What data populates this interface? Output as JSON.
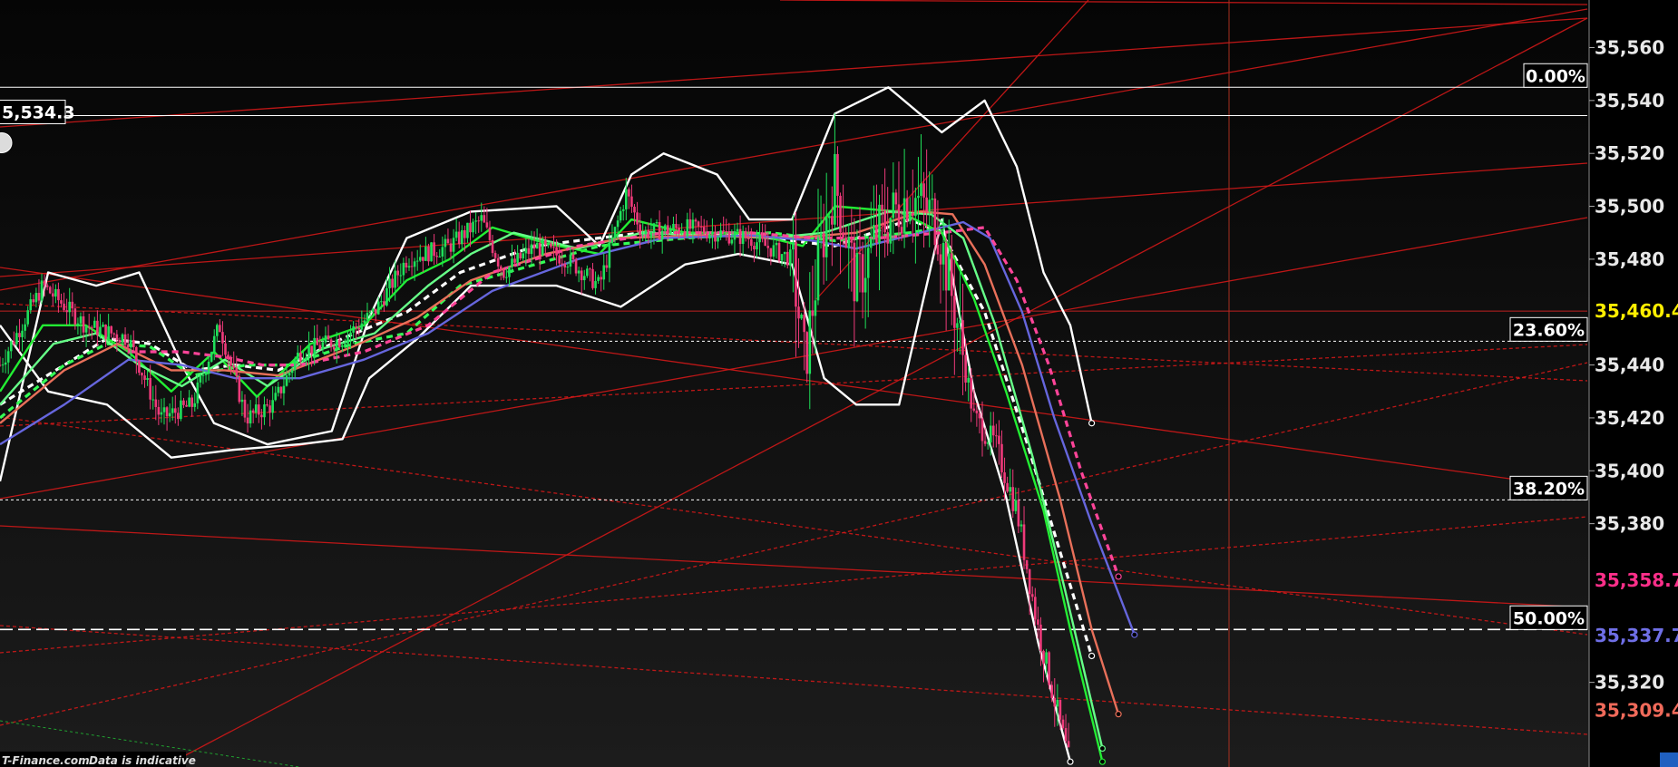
{
  "chart_data": {
    "type": "candlestick",
    "title": "",
    "xlabel": "",
    "ylabel": "",
    "ylim": [
      35288,
      35578
    ],
    "y_ticks": [
      "35,560",
      "35,540",
      "35,520",
      "35,500",
      "35,480",
      "35,440",
      "35,420",
      "35,400",
      "35,380",
      "35,320"
    ],
    "y_tick_values": [
      35560,
      35540,
      35520,
      35500,
      35480,
      35440,
      35420,
      35400,
      35380,
      35320
    ],
    "grid": false,
    "last_price": {
      "label": "35,460.4",
      "value": 35460.4,
      "color": "#ffee00"
    },
    "price_tags": [
      {
        "label": "35,358.7",
        "value": 35358.7,
        "color": "#ff2f8a"
      },
      {
        "label": "35,337.7",
        "value": 35337.7,
        "color": "#6f6fe6"
      },
      {
        "label": "35,309.4",
        "value": 35309.4,
        "color": "#f06a5a"
      }
    ],
    "high_marker": {
      "label": "5,534.3",
      "value": 35534.3
    },
    "fibonacci": [
      {
        "label": "0.00%",
        "value": 35545
      },
      {
        "label": "23.60%",
        "value": 35449
      },
      {
        "label": "38.20%",
        "value": 35389
      },
      {
        "label": "50.00%",
        "value": 35340
      }
    ],
    "price_path": [
      [
        0,
        35440
      ],
      [
        40,
        35470
      ],
      [
        80,
        35455
      ],
      [
        120,
        35450
      ],
      [
        150,
        35420
      ],
      [
        180,
        35425
      ],
      [
        205,
        35455
      ],
      [
        230,
        35420
      ],
      [
        255,
        35425
      ],
      [
        280,
        35445
      ],
      [
        320,
        35450
      ],
      [
        350,
        35460
      ],
      [
        380,
        35480
      ],
      [
        420,
        35485
      ],
      [
        450,
        35495
      ],
      [
        470,
        35475
      ],
      [
        500,
        35485
      ],
      [
        530,
        35480
      ],
      [
        560,
        35470
      ],
      [
        585,
        35505
      ],
      [
        600,
        35490
      ],
      [
        640,
        35492
      ],
      [
        700,
        35488
      ],
      [
        740,
        35480
      ],
      [
        752,
        35440
      ],
      [
        765,
        35480
      ],
      [
        780,
        35510
      ],
      [
        800,
        35470
      ],
      [
        820,
        35490
      ],
      [
        850,
        35505
      ],
      [
        875,
        35495
      ],
      [
        895,
        35455
      ],
      [
        910,
        35420
      ],
      [
        930,
        35410
      ],
      [
        950,
        35385
      ],
      [
        970,
        35340
      ],
      [
        990,
        35305
      ],
      [
        1000,
        35288
      ]
    ],
    "series": [
      {
        "color": "#ffffff",
        "dash": false,
        "values": [
          [
            0,
            35396
          ],
          [
            45,
            35475
          ],
          [
            90,
            35470
          ],
          [
            130,
            35475
          ],
          [
            170,
            35440
          ],
          [
            200,
            35418
          ],
          [
            250,
            35410
          ],
          [
            310,
            35415
          ],
          [
            345,
            35458
          ],
          [
            380,
            35488
          ],
          [
            440,
            35498
          ],
          [
            520,
            35500
          ],
          [
            560,
            35485
          ],
          [
            590,
            35512
          ],
          [
            620,
            35520
          ],
          [
            670,
            35512
          ],
          [
            700,
            35495
          ],
          [
            740,
            35495
          ],
          [
            780,
            35535
          ],
          [
            830,
            35545
          ],
          [
            880,
            35528
          ],
          [
            920,
            35540
          ],
          [
            950,
            35515
          ],
          [
            975,
            35475
          ],
          [
            1000,
            35455
          ],
          [
            1020,
            35418
          ]
        ]
      },
      {
        "color": "#ffffff",
        "dash": false,
        "values": [
          [
            0,
            35455
          ],
          [
            45,
            35430
          ],
          [
            100,
            35425
          ],
          [
            160,
            35405
          ],
          [
            220,
            35408
          ],
          [
            280,
            35410
          ],
          [
            320,
            35412
          ],
          [
            345,
            35435
          ],
          [
            390,
            35450
          ],
          [
            440,
            35470
          ],
          [
            520,
            35470
          ],
          [
            580,
            35462
          ],
          [
            640,
            35478
          ],
          [
            690,
            35482
          ],
          [
            740,
            35478
          ],
          [
            770,
            35435
          ],
          [
            800,
            35425
          ],
          [
            840,
            35425
          ],
          [
            880,
            35495
          ],
          [
            910,
            35430
          ],
          [
            940,
            35390
          ],
          [
            970,
            35335
          ],
          [
            1000,
            35290
          ]
        ]
      },
      {
        "color": "#ffffff",
        "dash": true,
        "values": [
          [
            0,
            35425
          ],
          [
            60,
            35440
          ],
          [
            100,
            35450
          ],
          [
            140,
            35448
          ],
          [
            180,
            35438
          ],
          [
            220,
            35440
          ],
          [
            260,
            35438
          ],
          [
            320,
            35450
          ],
          [
            380,
            35460
          ],
          [
            430,
            35475
          ],
          [
            500,
            35485
          ],
          [
            600,
            35490
          ],
          [
            700,
            35489
          ],
          [
            780,
            35485
          ],
          [
            850,
            35495
          ],
          [
            880,
            35490
          ],
          [
            920,
            35460
          ],
          [
            960,
            35410
          ],
          [
            990,
            35370
          ],
          [
            1020,
            35330
          ]
        ]
      },
      {
        "color": "#33ff55",
        "dash": true,
        "values": [
          [
            0,
            35420
          ],
          [
            60,
            35440
          ],
          [
            100,
            35448
          ],
          [
            140,
            35447
          ],
          [
            180,
            35436
          ],
          [
            230,
            35440
          ],
          [
            270,
            35440
          ],
          [
            330,
            35448
          ],
          [
            380,
            35452
          ],
          [
            430,
            35470
          ],
          [
            500,
            35478
          ],
          [
            560,
            35485
          ],
          [
            640,
            35488
          ],
          [
            720,
            35490
          ],
          [
            780,
            35487
          ],
          [
            850,
            35490
          ],
          [
            880,
            35492
          ]
        ]
      },
      {
        "color": "#22ee33",
        "dash": false,
        "values": [
          [
            0,
            35430
          ],
          [
            40,
            35455
          ],
          [
            80,
            35455
          ],
          [
            120,
            35445
          ],
          [
            160,
            35430
          ],
          [
            200,
            35445
          ],
          [
            240,
            35428
          ],
          [
            290,
            35448
          ],
          [
            340,
            35455
          ],
          [
            380,
            35472
          ],
          [
            420,
            35480
          ],
          [
            460,
            35492
          ],
          [
            510,
            35486
          ],
          [
            560,
            35482
          ],
          [
            590,
            35495
          ],
          [
            640,
            35490
          ],
          [
            700,
            35490
          ],
          [
            750,
            35485
          ],
          [
            780,
            35500
          ],
          [
            840,
            35498
          ],
          [
            880,
            35490
          ],
          [
            910,
            35465
          ],
          [
            940,
            35430
          ],
          [
            975,
            35385
          ],
          [
            1000,
            35340
          ],
          [
            1030,
            35290
          ]
        ]
      },
      {
        "color": "#66ff88",
        "dash": false,
        "values": [
          [
            0,
            35425
          ],
          [
            50,
            35448
          ],
          [
            90,
            35452
          ],
          [
            130,
            35440
          ],
          [
            170,
            35432
          ],
          [
            210,
            35442
          ],
          [
            250,
            35432
          ],
          [
            300,
            35446
          ],
          [
            350,
            35452
          ],
          [
            400,
            35470
          ],
          [
            440,
            35482
          ],
          [
            480,
            35490
          ],
          [
            540,
            35484
          ],
          [
            600,
            35490
          ],
          [
            660,
            35489
          ],
          [
            720,
            35488
          ],
          [
            770,
            35490
          ],
          [
            830,
            35498
          ],
          [
            870,
            35497
          ],
          [
            900,
            35488
          ],
          [
            930,
            35455
          ],
          [
            965,
            35405
          ],
          [
            995,
            35355
          ],
          [
            1030,
            35295
          ]
        ]
      },
      {
        "color": "#e8705a",
        "dash": false,
        "values": [
          [
            0,
            35418
          ],
          [
            60,
            35438
          ],
          [
            110,
            35448
          ],
          [
            160,
            35438
          ],
          [
            210,
            35438
          ],
          [
            260,
            35436
          ],
          [
            330,
            35447
          ],
          [
            390,
            35458
          ],
          [
            440,
            35472
          ],
          [
            510,
            35482
          ],
          [
            580,
            35488
          ],
          [
            660,
            35489
          ],
          [
            740,
            35488
          ],
          [
            800,
            35490
          ],
          [
            860,
            35498
          ],
          [
            890,
            35497
          ],
          [
            920,
            35478
          ],
          [
            955,
            35440
          ],
          [
            990,
            35390
          ],
          [
            1020,
            35340
          ],
          [
            1045,
            35308
          ]
        ]
      },
      {
        "color": "#6666dd",
        "dash": false,
        "values": [
          [
            0,
            35410
          ],
          [
            60,
            35425
          ],
          [
            120,
            35442
          ],
          [
            170,
            35440
          ],
          [
            220,
            35435
          ],
          [
            280,
            35435
          ],
          [
            340,
            35442
          ],
          [
            400,
            35452
          ],
          [
            460,
            35468
          ],
          [
            540,
            35480
          ],
          [
            620,
            35488
          ],
          [
            700,
            35489
          ],
          [
            760,
            35487
          ],
          [
            800,
            35484
          ],
          [
            860,
            35490
          ],
          [
            900,
            35494
          ],
          [
            925,
            35488
          ],
          [
            955,
            35460
          ],
          [
            985,
            35420
          ],
          [
            1020,
            35380
          ],
          [
            1060,
            35338
          ]
        ]
      },
      {
        "color": "#ff4499",
        "dash": true,
        "values": [
          [
            120,
            35445
          ],
          [
            170,
            35445
          ],
          [
            210,
            35443
          ],
          [
            245,
            35440
          ],
          [
            280,
            35440
          ],
          [
            340,
            35445
          ],
          [
            400,
            35455
          ],
          [
            460,
            35475
          ],
          [
            540,
            35485
          ],
          [
            620,
            35490
          ],
          [
            700,
            35490
          ],
          [
            760,
            35488
          ],
          [
            820,
            35488
          ],
          [
            880,
            35490
          ],
          [
            920,
            35492
          ],
          [
            950,
            35472
          ],
          [
            980,
            35440
          ],
          [
            1010,
            35400
          ],
          [
            1045,
            35360
          ]
        ]
      }
    ]
  },
  "footer": {
    "brand": "T-Finance.com",
    "note": "Data is indicative"
  }
}
